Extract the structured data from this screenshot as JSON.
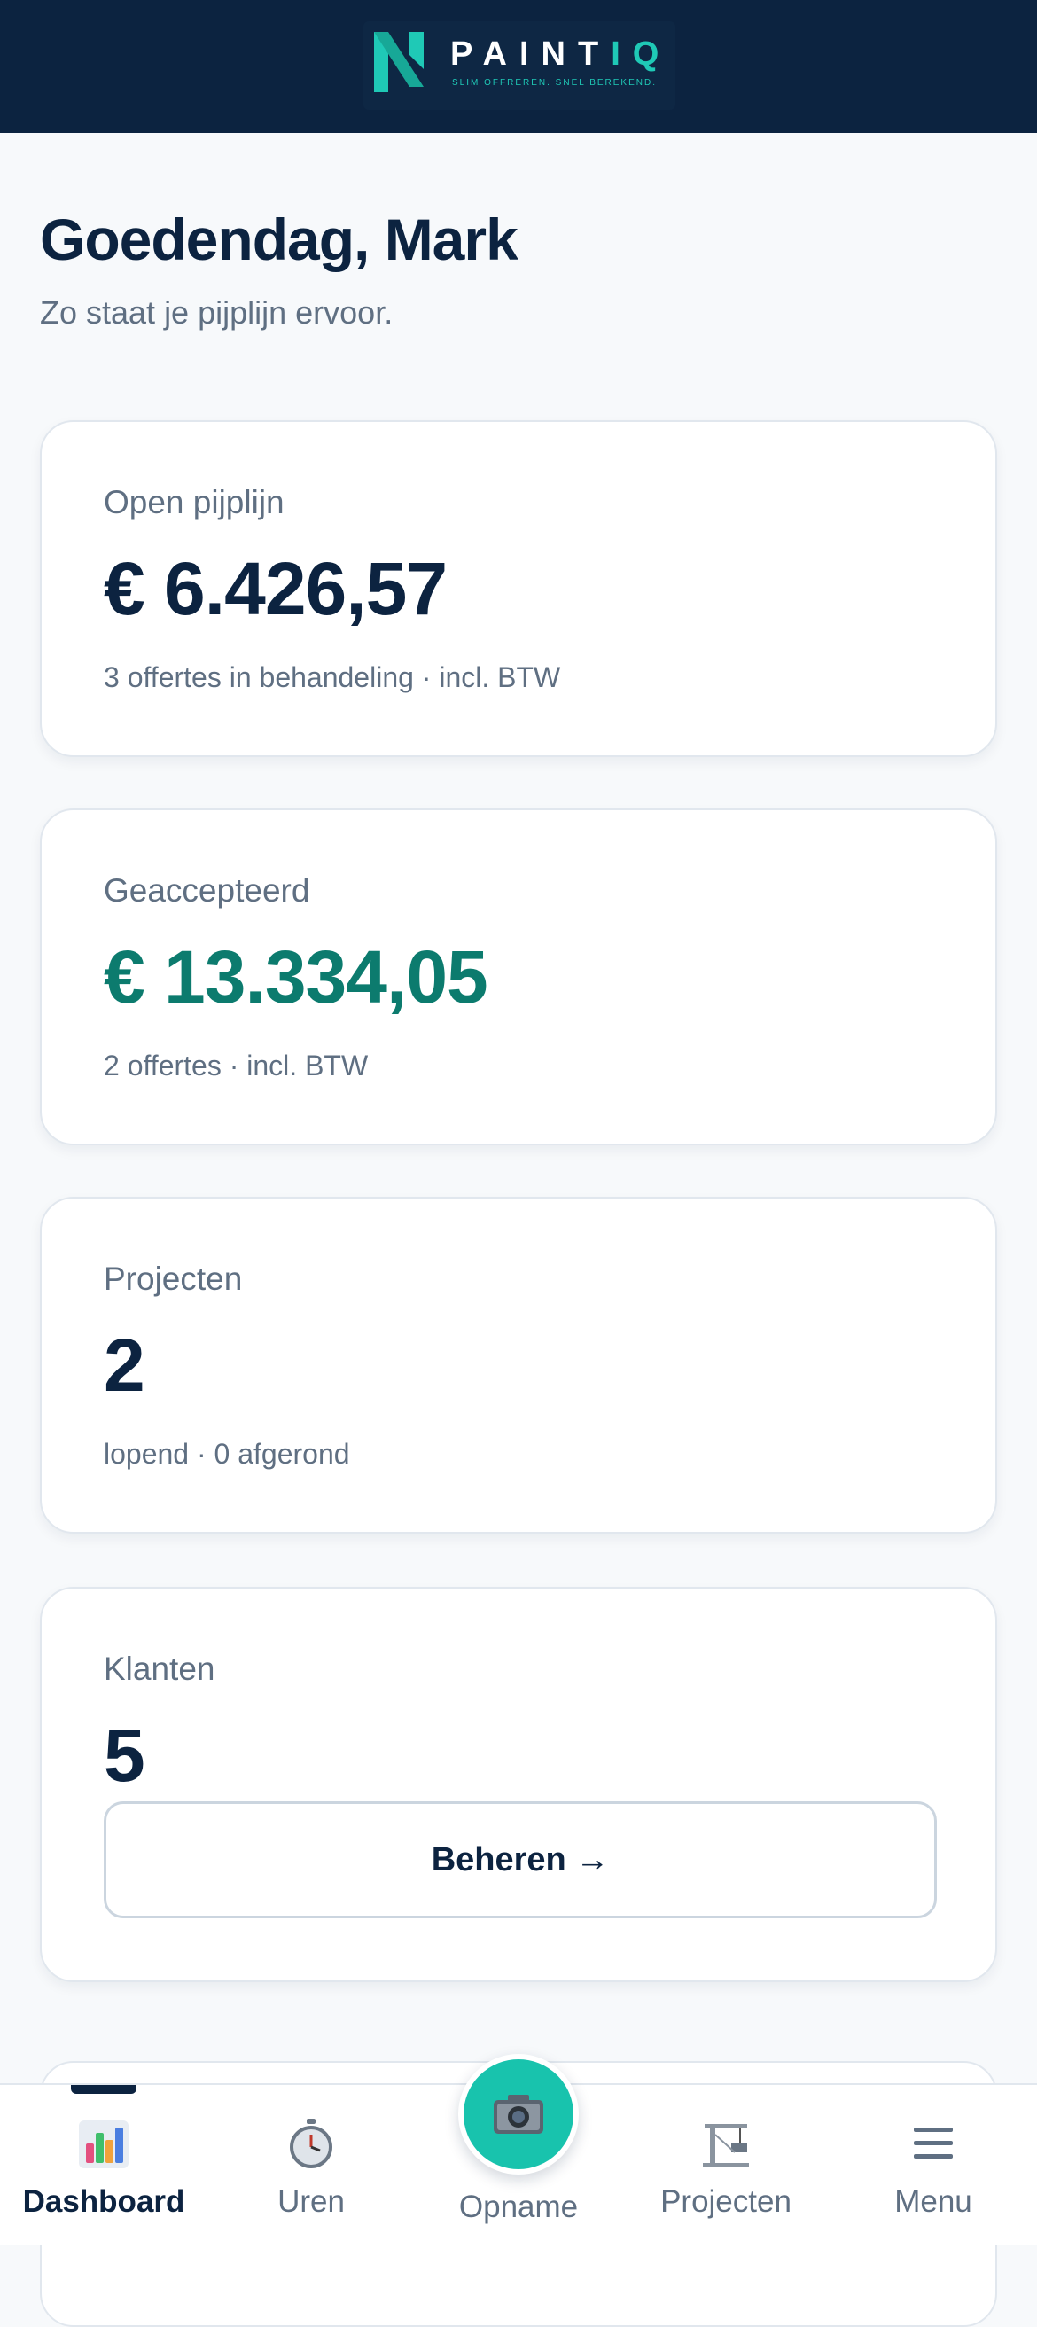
{
  "brand": {
    "word_main": "PAINT",
    "word_accent": "IQ",
    "tagline": "SLIM OFFREREN. SNEL BEREKEND.",
    "colors": {
      "navy": "#0c2340",
      "teal": "#1fc9b6",
      "green": "#0c7b6e"
    }
  },
  "greeting": {
    "title": "Goedendag, Mark",
    "subtitle": "Zo staat je pijplijn ervoor."
  },
  "cards": {
    "pipeline": {
      "label": "Open pijplijn",
      "value": "€ 6.426,57",
      "sub": "3 offertes in behandeling · incl. BTW"
    },
    "accepted": {
      "label": "Geaccepteerd",
      "value": "€ 13.334,05",
      "sub": "2 offertes · incl. BTW"
    },
    "projects": {
      "label": "Projecten",
      "value": "2",
      "sub": "lopend · 0 afgerond"
    },
    "clients": {
      "label": "Klanten",
      "value": "5",
      "button_label": "Beheren →"
    }
  },
  "nav": {
    "items": [
      {
        "label": "Dashboard",
        "icon": "bar-chart-icon",
        "active": true
      },
      {
        "label": "Uren",
        "icon": "stopwatch-icon",
        "active": false
      },
      {
        "label": "Opname",
        "icon": "camera-icon",
        "active": false
      },
      {
        "label": "Projecten",
        "icon": "crane-icon",
        "active": false
      },
      {
        "label": "Menu",
        "icon": "hamburger-icon",
        "active": false
      }
    ]
  }
}
